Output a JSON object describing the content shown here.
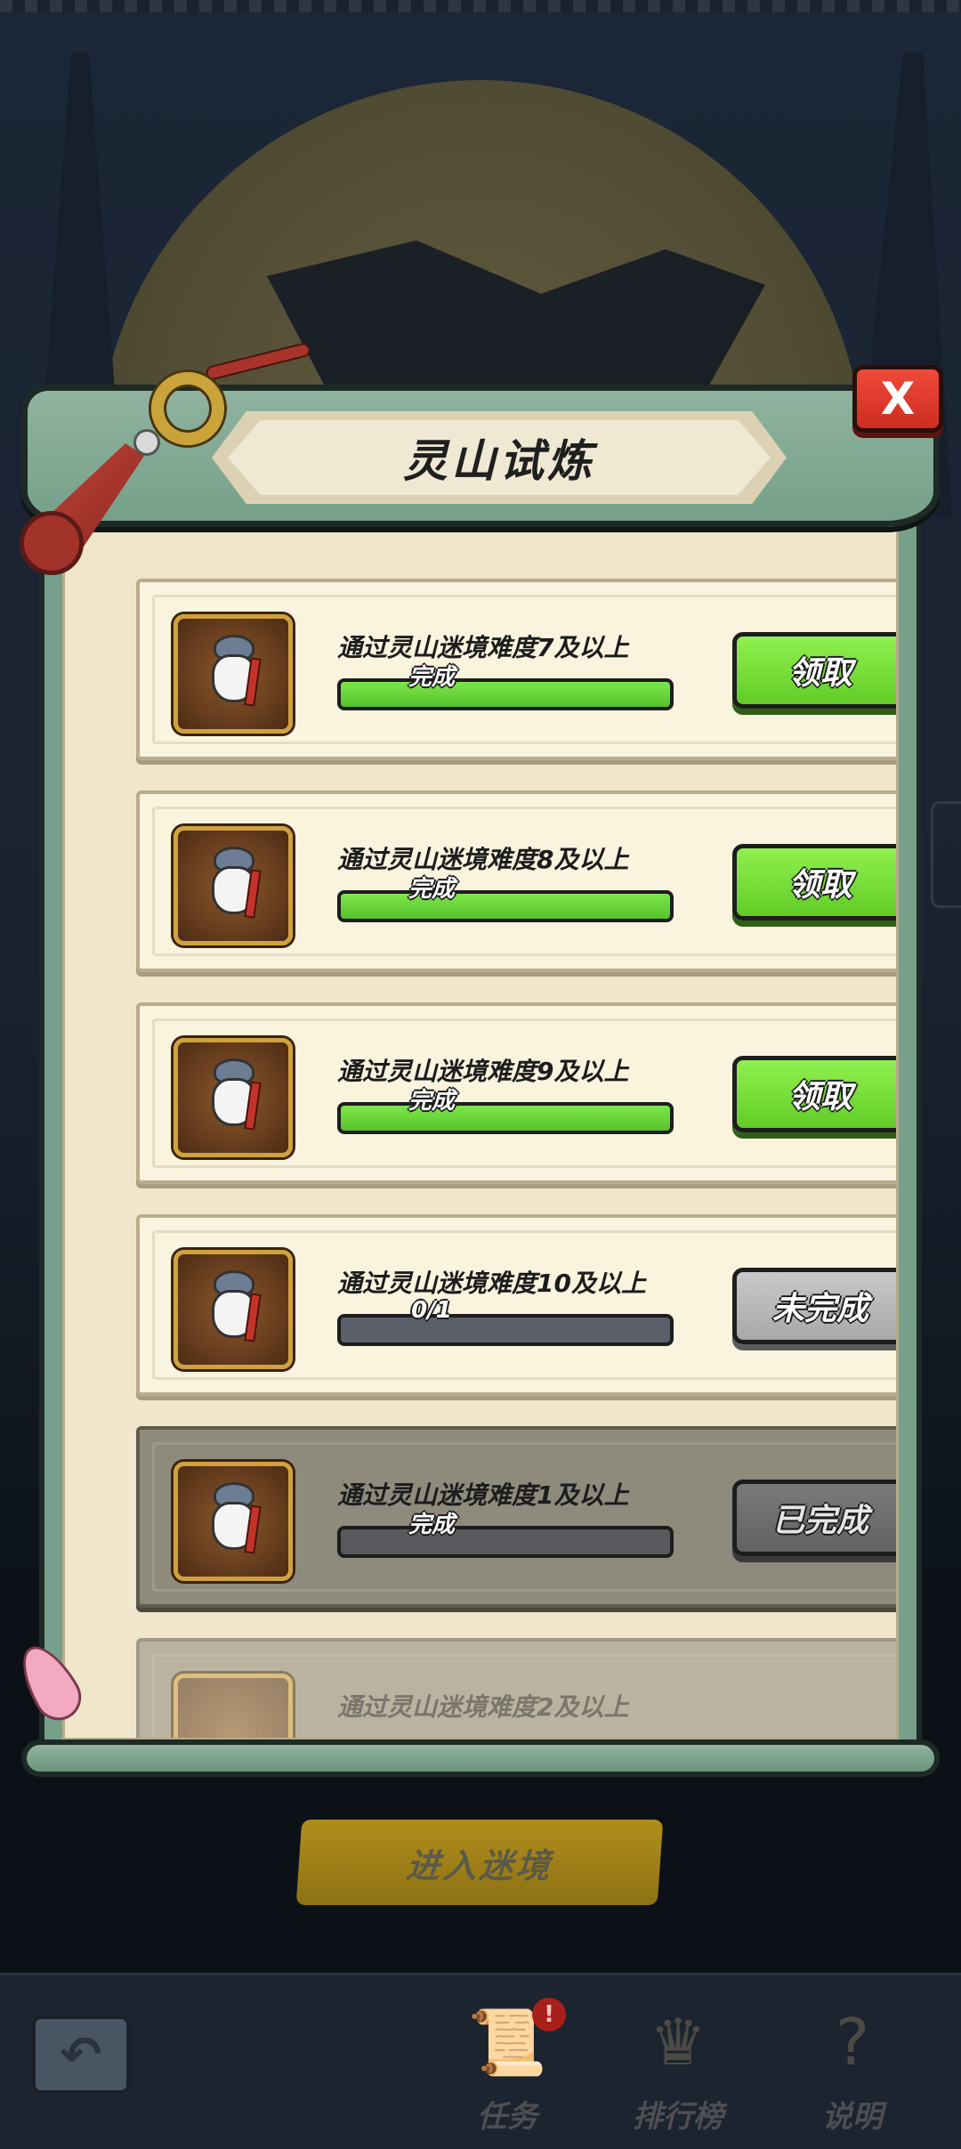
{
  "panel": {
    "title": "灵山试炼",
    "close_label": "X"
  },
  "colors": {
    "claim_green": "#62cc27",
    "incomplete_gray": "#a8a8a8",
    "completed_gray": "#626262",
    "close_red": "#cf2d22"
  },
  "tasks": [
    {
      "text": "通过灵山迷境难度7及以上",
      "progress_text": "完成",
      "progress": 1.0,
      "button": "领取",
      "state": "claim"
    },
    {
      "text": "通过灵山迷境难度8及以上",
      "progress_text": "完成",
      "progress": 1.0,
      "button": "领取",
      "state": "claim"
    },
    {
      "text": "通过灵山迷境难度9及以上",
      "progress_text": "完成",
      "progress": 1.0,
      "button": "领取",
      "state": "claim"
    },
    {
      "text": "通过灵山迷境难度10及以上",
      "progress_text": "0/1",
      "progress": 0.0,
      "button": "未完成",
      "state": "incomplete"
    },
    {
      "text": "通过灵山迷境难度1及以上",
      "progress_text": "完成",
      "progress": 1.0,
      "button": "已完成",
      "state": "completed"
    },
    {
      "text": "通过灵山迷境难度2及以上",
      "progress_text": "",
      "progress": 1.0,
      "button": "",
      "state": "completed"
    }
  ],
  "enter_button": "进入迷境",
  "bottom_nav": {
    "back_icon": "back-arrow-icon",
    "items": [
      {
        "label": "任务",
        "icon": "scroll-icon",
        "badge": "!"
      },
      {
        "label": "排行榜",
        "icon": "podium-icon"
      },
      {
        "label": "说明",
        "icon": "help-card-icon"
      }
    ]
  }
}
